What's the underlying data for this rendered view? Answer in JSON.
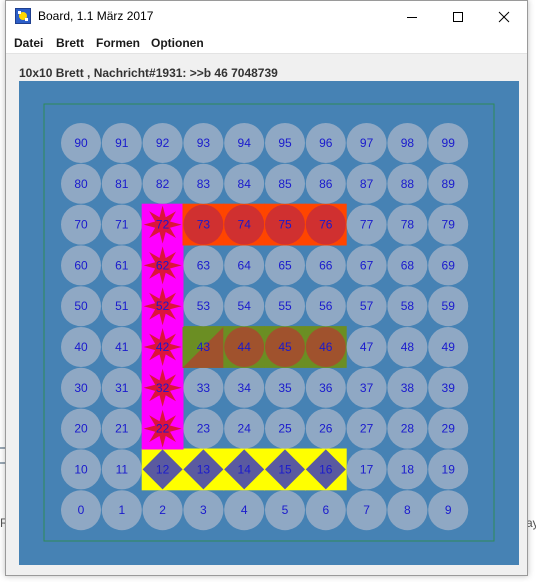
{
  "window": {
    "title": "Board, 1.1 März 2017",
    "controls": {
      "minimize": "minimize",
      "maximize": "maximize",
      "close": "close"
    }
  },
  "menu": {
    "items": [
      "Datei",
      "Brett",
      "Formen",
      "Optionen"
    ]
  },
  "status_line": "10x10 Brett , Nachricht#1931: >>b 46 7048739",
  "board": {
    "rows": 10,
    "cols": 10,
    "cell_numbers_by_row_top_to_bottom": [
      [
        90,
        91,
        92,
        93,
        94,
        95,
        96,
        97,
        98,
        99
      ],
      [
        80,
        81,
        82,
        83,
        84,
        85,
        86,
        87,
        88,
        89
      ],
      [
        70,
        71,
        72,
        73,
        74,
        75,
        76,
        77,
        78,
        79
      ],
      [
        60,
        61,
        62,
        63,
        64,
        65,
        66,
        67,
        68,
        69
      ],
      [
        50,
        51,
        52,
        53,
        54,
        55,
        56,
        57,
        58,
        59
      ],
      [
        40,
        41,
        42,
        43,
        44,
        45,
        46,
        47,
        48,
        49
      ],
      [
        30,
        31,
        32,
        33,
        34,
        35,
        36,
        37,
        38,
        39
      ],
      [
        20,
        21,
        22,
        23,
        24,
        25,
        26,
        27,
        28,
        29
      ],
      [
        10,
        11,
        12,
        13,
        14,
        15,
        16,
        17,
        18,
        19
      ],
      [
        0,
        1,
        2,
        3,
        4,
        5,
        6,
        7,
        8,
        9
      ]
    ],
    "colors": {
      "board_background": "#4682b4",
      "inner_frame": "#2e8b57",
      "circle_default": "#8fa8c4",
      "number_text": "#1a1acd",
      "magenta": "#ff00ff",
      "star": "#dc143c",
      "orange": "#ff4500",
      "red_circle": "#d03030",
      "olive": "#6b8e23",
      "brown": "#a0522d",
      "yellow": "#ffff00",
      "diamond": "#5a5aa0"
    },
    "highlight_cells": {
      "magenta_star": [
        72,
        62,
        52,
        42,
        32,
        22
      ],
      "orange_red_circle": [
        73,
        74,
        75,
        76
      ],
      "olive_brown_circle": [
        44,
        45,
        46
      ],
      "olive_brown_triangle": [
        43
      ],
      "yellow_diamond": [
        12,
        13,
        14,
        15,
        16
      ]
    }
  },
  "background_fragments": [
    "RI",
    "ay"
  ]
}
